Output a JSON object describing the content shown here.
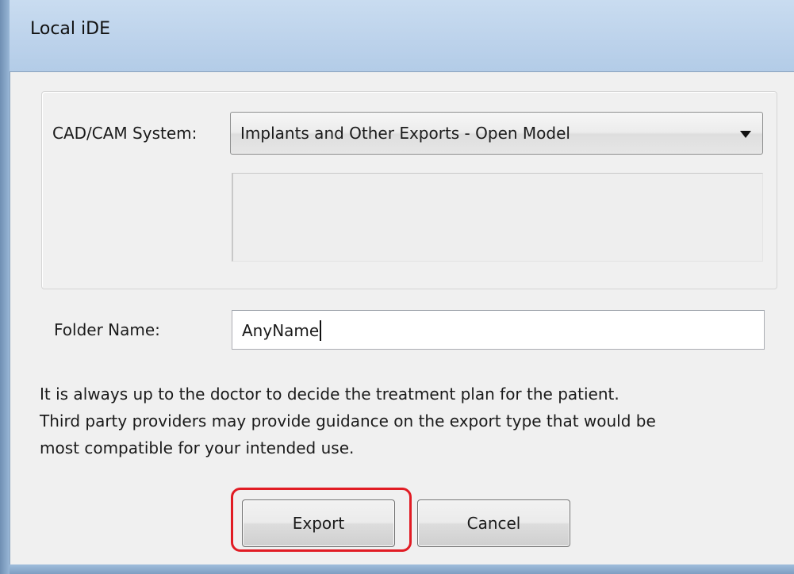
{
  "window": {
    "title": "Local iDE"
  },
  "cadcam": {
    "label": "CAD/CAM System:",
    "selected": "Implants and Other Exports - Open Model"
  },
  "folder": {
    "label": "Folder Name:",
    "value": "AnyName"
  },
  "notice": {
    "lines": [
      "It is always up to the doctor to decide the treatment plan for the patient.",
      "Third party providers may provide guidance on the export type that would be",
      "most compatible for your intended use."
    ]
  },
  "buttons": {
    "export": "Export",
    "cancel": "Cancel"
  },
  "colors": {
    "highlight": "#e11c24",
    "frame": "#b3cce7",
    "dialog_bg": "#f0f0f0"
  },
  "icons": {
    "dropdown": "chevron-down-icon"
  }
}
